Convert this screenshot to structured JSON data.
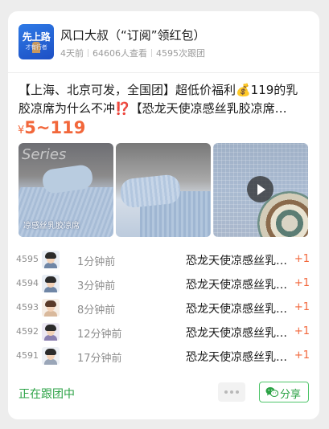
{
  "header": {
    "logo_line1": "先上路",
    "logo_line2": "才有行者",
    "title": "风口大叔（“订阅”领红包）",
    "meta": {
      "time_ago": "4天前",
      "views": "64606人查看",
      "followers": "4595次跟团"
    }
  },
  "post": {
    "description": "【上海、北京可发，全国团】超低价福利💰119的乳胶凉席为什么不冲⁉️【恐龙天使凉感丝乳胶凉席…",
    "price_currency": "¥",
    "price_range": "5~119",
    "images": [
      {
        "caption": "凉感丝乳胶凉席",
        "overlay": "Series"
      },
      {
        "caption": ""
      },
      {
        "caption": "",
        "has_video": true
      }
    ]
  },
  "orders": [
    {
      "number": "4595",
      "time": "1分钟前",
      "product": "恐龙天使凉感丝乳胶凉席",
      "qty": "+1"
    },
    {
      "number": "4594",
      "time": "3分钟前",
      "product": "恐龙天使凉感丝乳胶凉席",
      "qty": "+1"
    },
    {
      "number": "4593",
      "time": "8分钟前",
      "product": "恐龙天使凉感丝乳胶凉席",
      "qty": "+1"
    },
    {
      "number": "4592",
      "time": "12分钟前",
      "product": "恐龙天使凉感丝乳胶凉席",
      "qty": "+1"
    },
    {
      "number": "4591",
      "time": "17分钟前",
      "product": "恐龙天使凉感丝乳胶凉席",
      "qty": "+1"
    }
  ],
  "footer": {
    "status": "正在跟团中",
    "more_icon": "more-dots-icon",
    "share_label": "分享",
    "share_icon": "wechat-icon"
  },
  "colors": {
    "accent_orange": "#f2673b",
    "accent_green": "#2ba245"
  }
}
